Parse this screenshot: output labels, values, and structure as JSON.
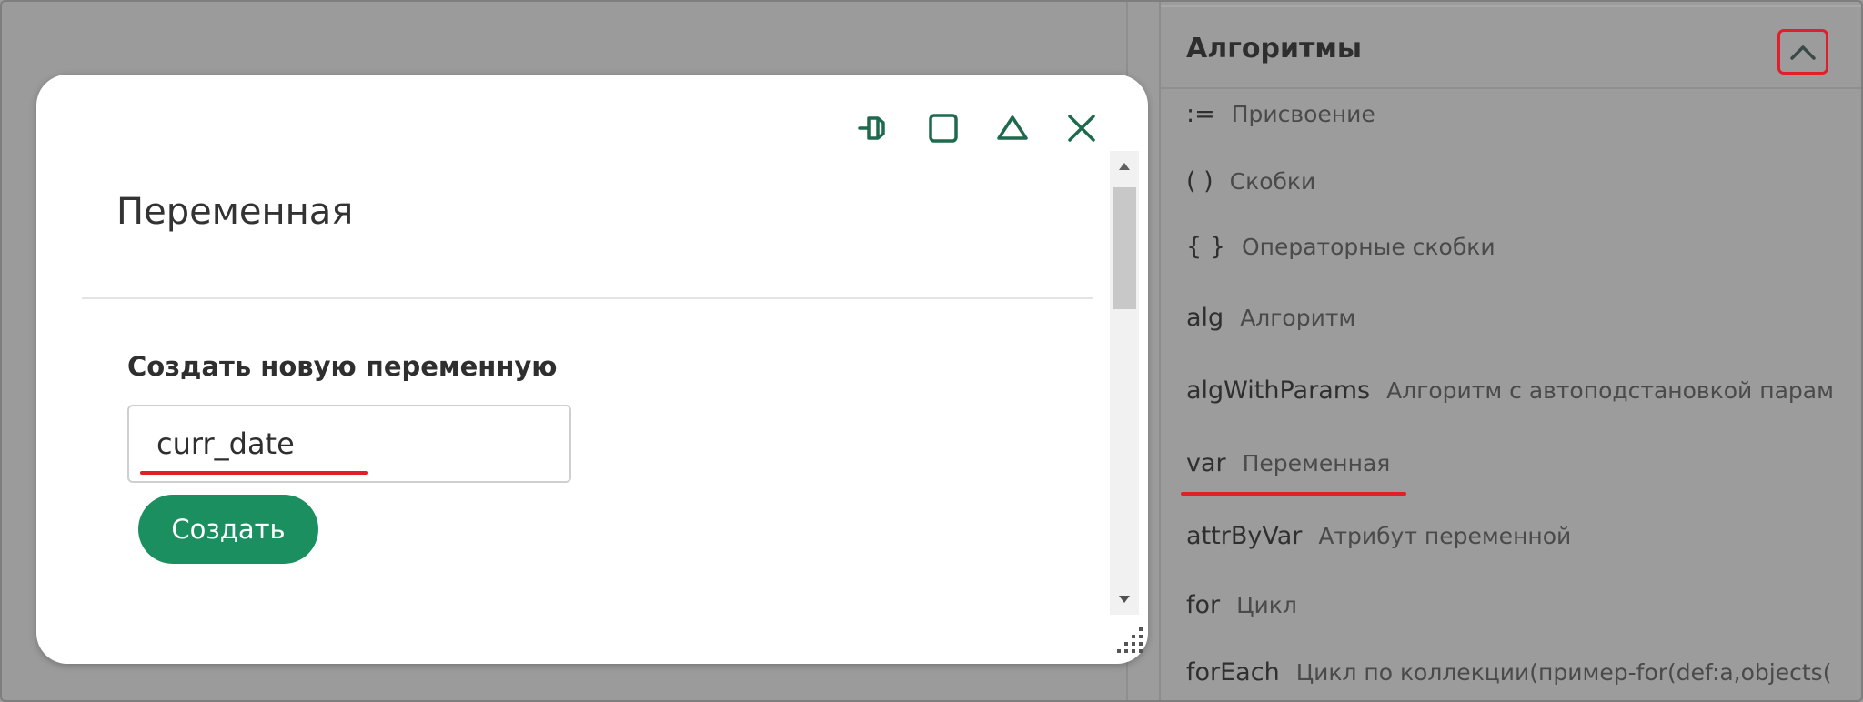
{
  "panel": {
    "title": "Алгоритмы",
    "items": [
      {
        "code": ":=",
        "desc": "Присвоение"
      },
      {
        "code": "( )",
        "desc": "Скобки"
      },
      {
        "code": "{ }",
        "desc": "Операторные скобки"
      },
      {
        "code": "alg",
        "desc": "Алгоритм"
      },
      {
        "code": "algWithParams",
        "desc": "Алгоритм с автоподстановкой парам"
      },
      {
        "code": "var",
        "desc": "Переменная"
      },
      {
        "code": "attrByVar",
        "desc": "Атрибут переменной"
      },
      {
        "code": "for",
        "desc": "Цикл"
      },
      {
        "code": "forEach",
        "desc": "Цикл по коллекции(пример-for(def:a,objects("
      }
    ]
  },
  "dialog": {
    "title": "Переменная",
    "section_label": "Создать новую переменную",
    "input_value": "curr_date",
    "create_label": "Создать"
  },
  "colors": {
    "accent": "#1b8f5f",
    "highlight": "#e01f2b"
  }
}
